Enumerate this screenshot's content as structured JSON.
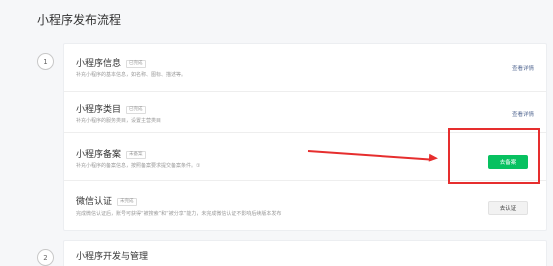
{
  "page": {
    "title": "小程序发布流程"
  },
  "steps": [
    {
      "number": "1"
    },
    {
      "number": "2",
      "title": "小程序开发与管理"
    }
  ],
  "rows": [
    {
      "title": "小程序信息",
      "badge": "已完成",
      "description": "补充小程序的基本信息，如名称、图标、描述等。",
      "action": "查看详情"
    },
    {
      "title": "小程序类目",
      "badge": "已完成",
      "description": "补充小程序的服务类目，设置主营类目",
      "action": "查看详情"
    },
    {
      "title": "小程序备案",
      "badge": "未备案",
      "description": "补充小程序的备案信息，按照备案要求提交备案条件。①",
      "action": "去备案"
    },
    {
      "title": "微信认证",
      "badge": "未完成",
      "description": "完成微信认证后，账号可获得“被搜索”和“被分享”能力，未完成微信认证不影响后续版本发布",
      "action": "去认证"
    }
  ],
  "annotation": {
    "color": "#e62e2e"
  },
  "colors": {
    "primary": "#07c160",
    "link": "#576b95"
  }
}
